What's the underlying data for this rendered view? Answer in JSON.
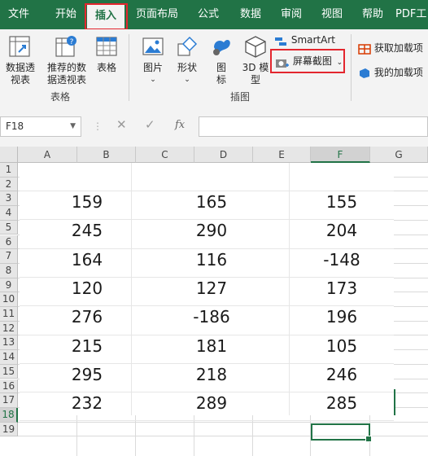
{
  "tabs": [
    "文件",
    "开始",
    "插入",
    "页面布局",
    "公式",
    "数据",
    "审阅",
    "视图",
    "帮助",
    "PDF工"
  ],
  "ribbon": {
    "pivot_table": "数据透视表",
    "recommended_pivot": "推荐的数据透视表",
    "table": "表格",
    "tables_group": "表格",
    "pictures": "图片",
    "shapes": "形状",
    "icons": "图标",
    "model_3d": "3D 模型",
    "smartart": "SmartArt",
    "screenshot": "屏幕截图",
    "illustrations_group": "插图",
    "get_addins": "获取加载项",
    "my_addins": "我的加载项"
  },
  "formula_bar": {
    "name_box": "F18",
    "fx": "fx",
    "formula": ""
  },
  "columns": [
    "A",
    "B",
    "C",
    "D",
    "E",
    "F",
    "G"
  ],
  "rows": [
    "1",
    "2",
    "3",
    "4",
    "5",
    "6",
    "7",
    "8",
    "9",
    "10",
    "11",
    "12",
    "13",
    "14",
    "15",
    "16",
    "17",
    "18",
    "19"
  ],
  "selected_cell": "F18",
  "table": [
    [
      "159",
      "165",
      "155"
    ],
    [
      "245",
      "290",
      "204"
    ],
    [
      "164",
      "116",
      "-148"
    ],
    [
      "120",
      "127",
      "173"
    ],
    [
      "276",
      "-186",
      "196"
    ],
    [
      "215",
      "181",
      "105"
    ],
    [
      "295",
      "218",
      "246"
    ],
    [
      "232",
      "289",
      "285"
    ]
  ],
  "colors": {
    "accent": "#217346",
    "highlight": "#e3262e"
  }
}
